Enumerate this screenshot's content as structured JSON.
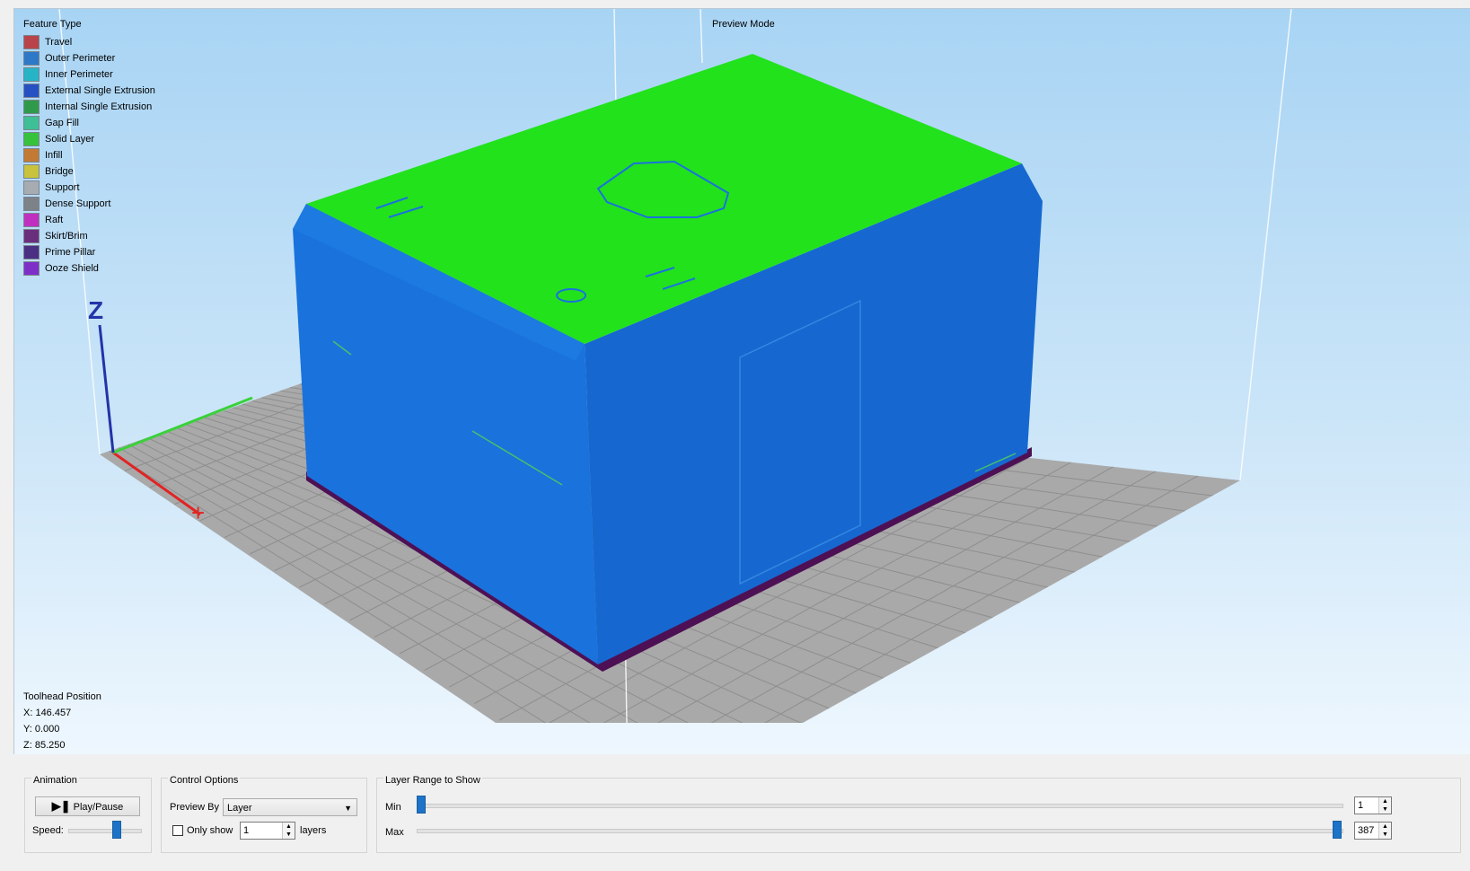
{
  "viewport": {
    "preview_mode_label": "Preview Mode",
    "legend": {
      "title": "Feature Type",
      "items": [
        {
          "label": "Travel",
          "color": "#b9434a"
        },
        {
          "label": "Outer Perimeter",
          "color": "#2d79c7"
        },
        {
          "label": "Inner Perimeter",
          "color": "#27b4c7"
        },
        {
          "label": "External Single Extrusion",
          "color": "#2551c2"
        },
        {
          "label": "Internal Single Extrusion",
          "color": "#2f9a4a"
        },
        {
          "label": "Gap Fill",
          "color": "#3fbf95"
        },
        {
          "label": "Solid Layer",
          "color": "#37c23b"
        },
        {
          "label": "Infill",
          "color": "#c27a35"
        },
        {
          "label": "Bridge",
          "color": "#c8c23c"
        },
        {
          "label": "Support",
          "color": "#a6acb2"
        },
        {
          "label": "Dense Support",
          "color": "#7d8188"
        },
        {
          "label": "Raft",
          "color": "#c02fc0"
        },
        {
          "label": "Skirt/Brim",
          "color": "#6a2f7c"
        },
        {
          "label": "Prime Pillar",
          "color": "#4a2f82"
        },
        {
          "label": "Ooze Shield",
          "color": "#7d2fc8"
        }
      ]
    },
    "toolhead": {
      "title": "Toolhead Position",
      "x": "X: 146.457",
      "y": "Y: 0.000",
      "z": "Z: 85.250"
    },
    "scene": {
      "model_top_color": "#22e21c",
      "model_side_color": "#1a72dc",
      "model_side_dark": "#1664c4",
      "brim_color": "#4e1055",
      "bed_color": "#a9a9a9",
      "grid_color": "#8e8e8e",
      "axis_x_color": "#e02424",
      "axis_y_color": "#3ad13a",
      "axis_z_color": "#2234a8",
      "axis_z_label": "Z"
    }
  },
  "controls": {
    "animation": {
      "title": "Animation",
      "play_pause_label": "Play/Pause",
      "speed_label": "Speed:"
    },
    "control_options": {
      "title": "Control Options",
      "preview_by_label": "Preview By",
      "preview_by_value": "Layer",
      "only_show_label": "Only show",
      "only_show_value": "1",
      "layers_label": "layers"
    },
    "layer_range": {
      "title": "Layer Range to Show",
      "min_label": "Min",
      "max_label": "Max",
      "min_value": "1",
      "max_value": "387"
    }
  }
}
